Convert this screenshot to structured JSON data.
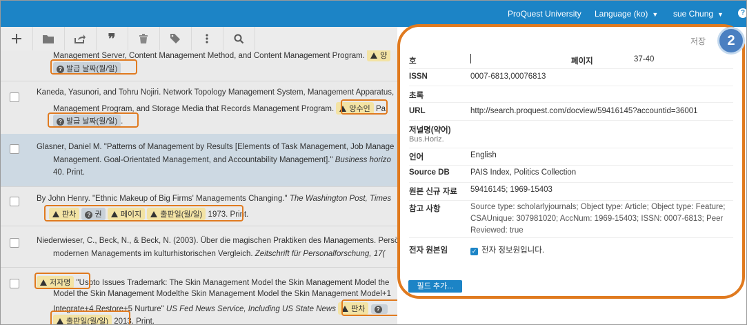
{
  "topbar": {
    "institution": "ProQuest University",
    "language": "Language (ko)",
    "user": "sue Chung",
    "help": "?"
  },
  "toolbar": {
    "icons": [
      "add-icon",
      "folder-icon",
      "share-icon",
      "quote-icon",
      "trash-icon",
      "tag-icon",
      "more-icon",
      "search-icon"
    ]
  },
  "list": {
    "e1": {
      "text1": "Management Server, Content Management Method, and Content Management Program.",
      "badge1": "양",
      "badge2": "발급 날짜(월/일)"
    },
    "e2": {
      "text1": "Kaneda, Yasunori, and Tohru Nojiri. Network Topology Management System, Management Apparatus,",
      "text2": "Management Program, and Storage Media that Records Management Program.",
      "badge1": "양수인",
      "tail": "Pa",
      "badge2": "발급 날짜(월/일)",
      "dot": "."
    },
    "e3": {
      "text1": "Glasner, Daniel M. \"Patterns of Management by Results [Elements of Task Management, Job Manage",
      "text2a": "Management. Goal-Orientated Management, and Accountability Management].\"",
      "text2b": "Business horizo",
      "text3": "40. Print."
    },
    "e4": {
      "text1a": "By John Henry. \"Ethnic Makeup of Big Firms' Managements Changing.\"",
      "text1b": "The Washington Post, Times",
      "b1": "판차",
      "b2": "권",
      "b3": "페이지",
      "b4": "출판일(월/일)",
      "tail": "1973. Print."
    },
    "e5": {
      "text1": "Niederwieser, C., Beck, N., & Beck, N. (2003). Über die magischen Praktiken des Managements. Persö",
      "text2a": "modernen Managements im kulturhistorischen Vergleich.",
      "text2b": "Zeitschrift für Personalforschung, 17("
    },
    "e6": {
      "badge1": "저자명",
      "text1": "\"Uspto Issues Trademark: The Skin Management Model the Skin Management Model the",
      "text2": "Model the Skin Management Modelthe Skin Management Model the Skin Management Model+1",
      "text3a": "Integrate+4 Restore+5 Nurture\"",
      "text3b": "US Fed News Service, Including US State News",
      "badge2": "판차",
      "badge3": "출판일(월/일)",
      "tail": "2013. Print."
    }
  },
  "panel": {
    "save": "저장",
    "step": "2",
    "issue_label": "호",
    "page_label": "페이지",
    "page_value": "37-40",
    "issn_label": "ISSN",
    "issn_value": "0007-6813,00076813",
    "abstract_label": "초록",
    "url_label": "URL",
    "url_value": "http://search.proquest.com/docview/59416145?accountid=36001",
    "journal_abbr_label": "저널명(약어)",
    "journal_abbr_value": "Bus.Horiz.",
    "language_label": "언어",
    "language_value": "English",
    "source_label": "Source DB",
    "source_value": "PAIS Index, Politics Collection",
    "archive_label": "원본 신규 자료",
    "archive_value": "59416145; 1969-15403",
    "notes_label": "참고 사항",
    "notes_line1": "Source type: scholarlyjournals; Object type: Article; Object type: Feature;",
    "notes_line2": "CSAUnique: 307981020; AccNum: 1969-15403; ISSN: 0007-6813; Peer",
    "notes_line3": "Reviewed: true",
    "electronic_label": "전자 원본임",
    "electronic_value": "전자 정보원입니다.",
    "add_field": "필드 추가..."
  }
}
